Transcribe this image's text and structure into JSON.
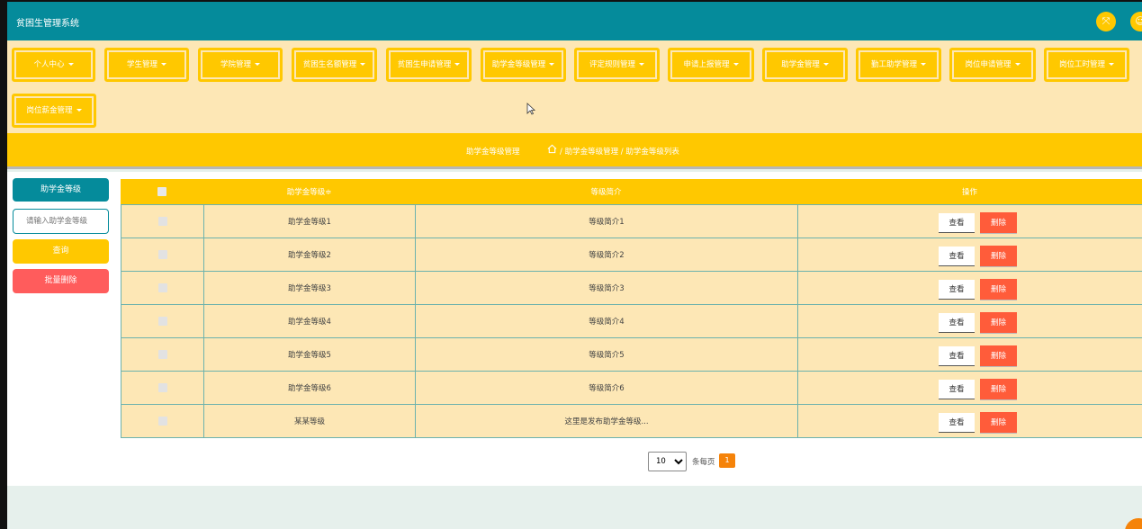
{
  "app": {
    "title": "贫困生管理系统"
  },
  "header_icons": [
    "expand-icon",
    "user-icon"
  ],
  "nav": {
    "menus": [
      "个人中心",
      "学生管理",
      "学院管理",
      "贫困生名额管理",
      "贫困生申请管理",
      "助学金等级管理",
      "评定规则管理",
      "申请上报管理",
      "助学金管理",
      "勤工助学管理",
      "岗位申请管理",
      "岗位工时管理",
      "岗位薪金管理"
    ]
  },
  "breadcrumb": {
    "section": "助学金等级管理",
    "path": "/ 助学金等级管理 / 助学金等级列表"
  },
  "search": {
    "label": "助学金等级",
    "placeholder": "请输入助学金等级",
    "search_button": "查询",
    "batch_delete_button": "批量删除"
  },
  "table": {
    "columns": {
      "name": "助学金等级≑",
      "desc": "等级简介",
      "ops": "操作"
    },
    "rows": [
      {
        "name": "助学金等级1",
        "desc": "等级简介1"
      },
      {
        "name": "助学金等级2",
        "desc": "等级简介2"
      },
      {
        "name": "助学金等级3",
        "desc": "等级简介3"
      },
      {
        "name": "助学金等级4",
        "desc": "等级简介4"
      },
      {
        "name": "助学金等级5",
        "desc": "等级简介5"
      },
      {
        "name": "助学金等级6",
        "desc": "等级简介6"
      },
      {
        "name": "某某等级",
        "desc": "这里是发布助学金等级..."
      }
    ],
    "view_label": "查看",
    "delete_label": "删除"
  },
  "pagination": {
    "page_size": "10",
    "per_page_label": "条每页",
    "current_page": "1"
  },
  "colors": {
    "header": "#058b9b",
    "accent": "#ffc800",
    "nav_bg": "#fde7b5",
    "danger": "#ff5c5c",
    "page_active": "#f5830a"
  }
}
